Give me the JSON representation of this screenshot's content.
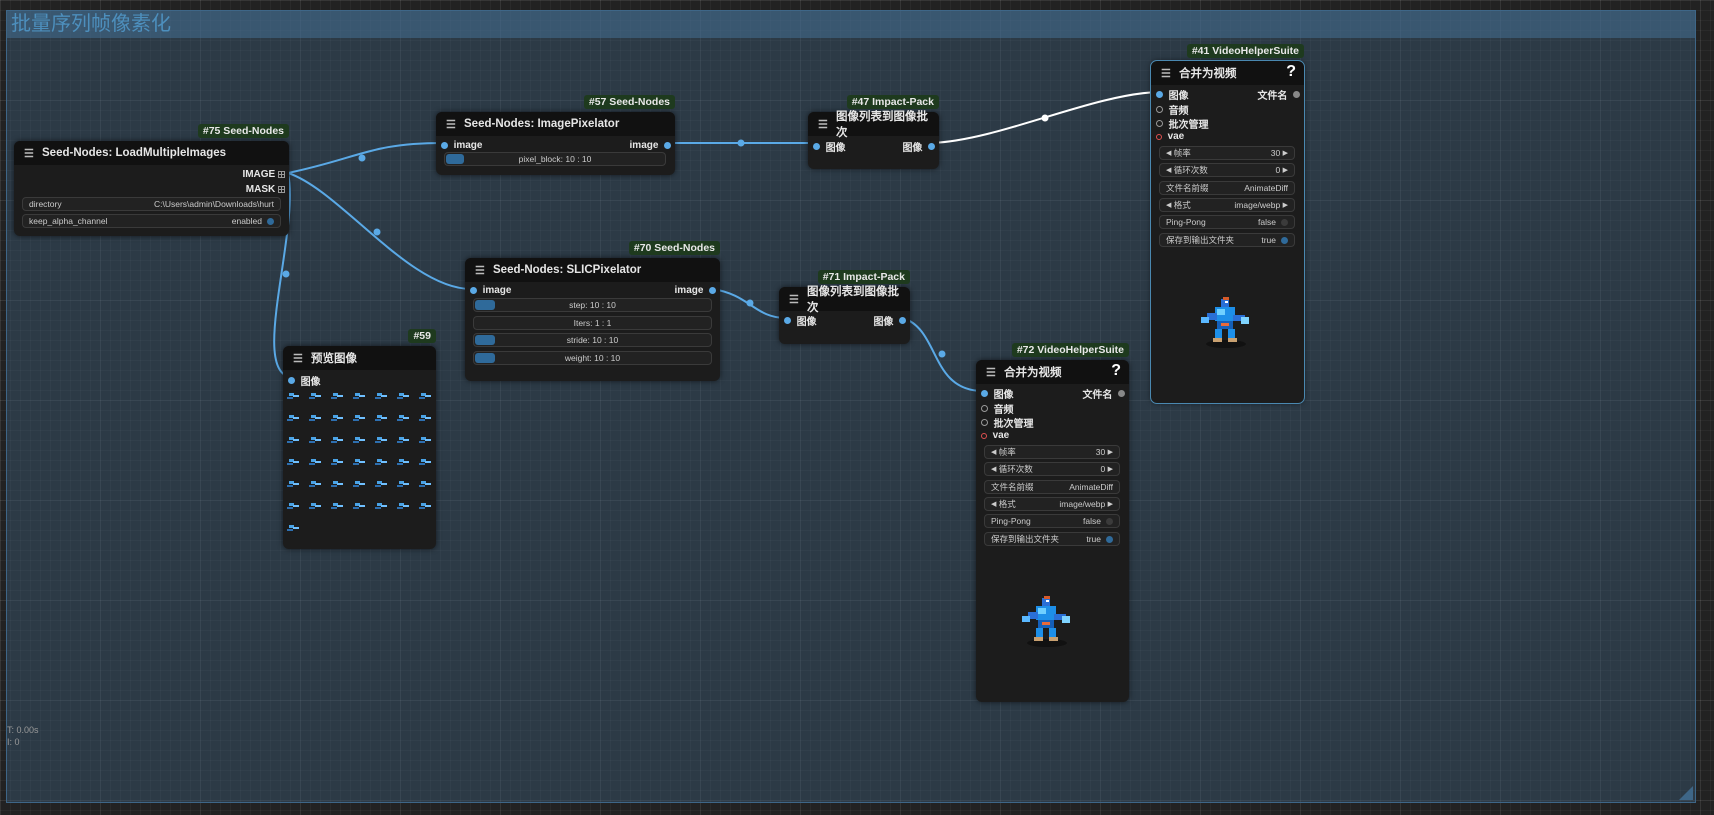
{
  "group": {
    "title": "批量序列帧像素化"
  },
  "status": {
    "time": "T: 0.00s",
    "index": "I: 0"
  },
  "nodes": {
    "n75": {
      "badge": "#75 Seed-Nodes",
      "title": "Seed-Nodes: LoadMultipleImages",
      "out1": "IMAGE",
      "out2": "MASK",
      "w1_label": "directory",
      "w1_value": "C:\\Users\\admin\\Downloads\\hurt",
      "w2_label": "keep_alpha_channel",
      "w2_value": "enabled"
    },
    "n57": {
      "badge": "#57 Seed-Nodes",
      "title": "Seed-Nodes: ImagePixelator",
      "in1": "image",
      "out1": "image",
      "w1": "pixel_block: 10 : 10"
    },
    "n70": {
      "badge": "#70 Seed-Nodes",
      "title": "Seed-Nodes: SLICPixelator",
      "in1": "image",
      "out1": "image",
      "w1": "step: 10 : 10",
      "w2": "Iters: 1 : 1",
      "w3": "stride: 10 : 10",
      "w4": "weight: 10 : 10"
    },
    "n59": {
      "badge": "#59",
      "title": "预览图像",
      "in1": "图像"
    },
    "n47": {
      "badge": "#47 Impact-Pack",
      "title": "图像列表到图像批次",
      "in1": "图像",
      "out1": "图像"
    },
    "n71": {
      "badge": "#71 Impact-Pack",
      "title": "图像列表到图像批次",
      "in1": "图像",
      "out1": "图像"
    },
    "n41": {
      "badge": "#41 VideoHelperSuite",
      "title": "合并为视频",
      "help": "?",
      "in1": "图像",
      "in2": "音频",
      "in3": "批次管理",
      "in4": "vae",
      "out1": "文件名",
      "fps_label": "帧率",
      "fps_value": "30",
      "loop_label": "循环次数",
      "loop_value": "0",
      "prefix_label": "文件名前缀",
      "prefix_value": "AnimateDiff",
      "format_label": "格式",
      "format_value": "image/webp",
      "pingpong_label": "Ping-Pong",
      "pingpong_value": "false",
      "save_label": "保存到输出文件夹",
      "save_value": "true"
    },
    "n72": {
      "badge": "#72 VideoHelperSuite",
      "title": "合并为视频",
      "help": "?",
      "in1": "图像",
      "in2": "音频",
      "in3": "批次管理",
      "in4": "vae",
      "out1": "文件名",
      "fps_label": "帧率",
      "fps_value": "30",
      "loop_label": "循环次数",
      "loop_value": "0",
      "prefix_label": "文件名前缀",
      "prefix_value": "AnimateDiff",
      "format_label": "格式",
      "format_value": "image/webp",
      "pingpong_label": "Ping-Pong",
      "pingpong_value": "false",
      "save_label": "保存到输出文件夹",
      "save_value": "true"
    }
  },
  "colors": {
    "link": "#5aa9e6",
    "link_selected": "#ffffff",
    "group_title": "#4d8fbd",
    "badge_bg": "#1e3a1e"
  }
}
